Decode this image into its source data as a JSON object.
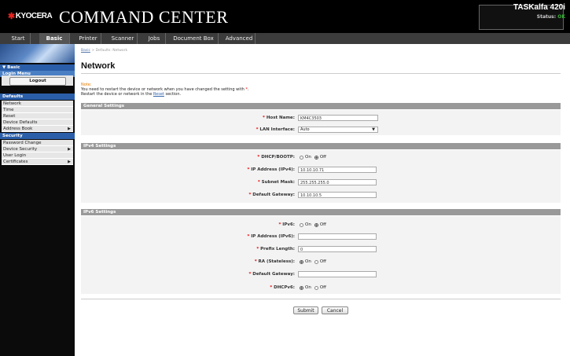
{
  "header": {
    "logo_text": "KYOCERA",
    "app_title": "COMMAND CENTER",
    "device_name": "TASKalfa 420i",
    "status_label": "Status:",
    "status_value": "OK"
  },
  "tabs": [
    {
      "label": "Start"
    },
    {
      "label": "Basic"
    },
    {
      "label": "Printer"
    },
    {
      "label": "Scanner"
    },
    {
      "label": "Jobs"
    },
    {
      "label": "Document Box"
    },
    {
      "label": "Advanced"
    }
  ],
  "sidebar": {
    "basic_header": "▼ Basic",
    "login_menu": "Login Menu",
    "logout": "Logout",
    "defaults_header": "Defaults",
    "defaults_items": [
      "Network",
      "Time",
      "Reset",
      "Device Defaults",
      "Address Book"
    ],
    "security_header": "Security",
    "security_items": [
      "Password Change",
      "Device Security",
      "User Login",
      "Certificates"
    ]
  },
  "breadcrumb": {
    "link": "Basic",
    "separator": " > ",
    "current": "Defaults: Network"
  },
  "page_title": "Network",
  "note": {
    "label": "Note:",
    "line1_a": "You need to restart the device or network when you have changed the setting with ",
    "star": "*",
    "line1_b": ".",
    "line2_a": "Restart the device or network in the ",
    "reset_link": "Reset",
    "line2_b": " section."
  },
  "general": {
    "title": "General Settings",
    "host_name_label": "Host Name:",
    "host_name_value": "KM4C3503",
    "lan_label": "LAN Interface:",
    "lan_value": "Auto"
  },
  "ipv4": {
    "title": "IPv4 Settings",
    "dhcp_label": "DHCP/BOOTP:",
    "ip_label": "IP Address (IPv4):",
    "ip_value": "10.10.10.71",
    "mask_label": "Subnet Mask:",
    "mask_value": "255.255.255.0",
    "gateway_label": "Default Gateway:",
    "gateway_value": "10.10.10.5"
  },
  "ipv6": {
    "title": "IPv6 Settings",
    "ipv6_label": "IPv6:",
    "ip_label": "IP Address (IPv6):",
    "ip_value": "",
    "prefix_label": "Prefix Length:",
    "prefix_value": "0",
    "ra_label": "RA (Stateless):",
    "gateway_label": "Default Gateway:",
    "gateway_value": "",
    "dhcpv6_label": "DHCPv6:"
  },
  "radio_labels": {
    "on": "On",
    "off": "Off"
  },
  "buttons": {
    "submit": "Submit",
    "cancel": "Cancel"
  }
}
